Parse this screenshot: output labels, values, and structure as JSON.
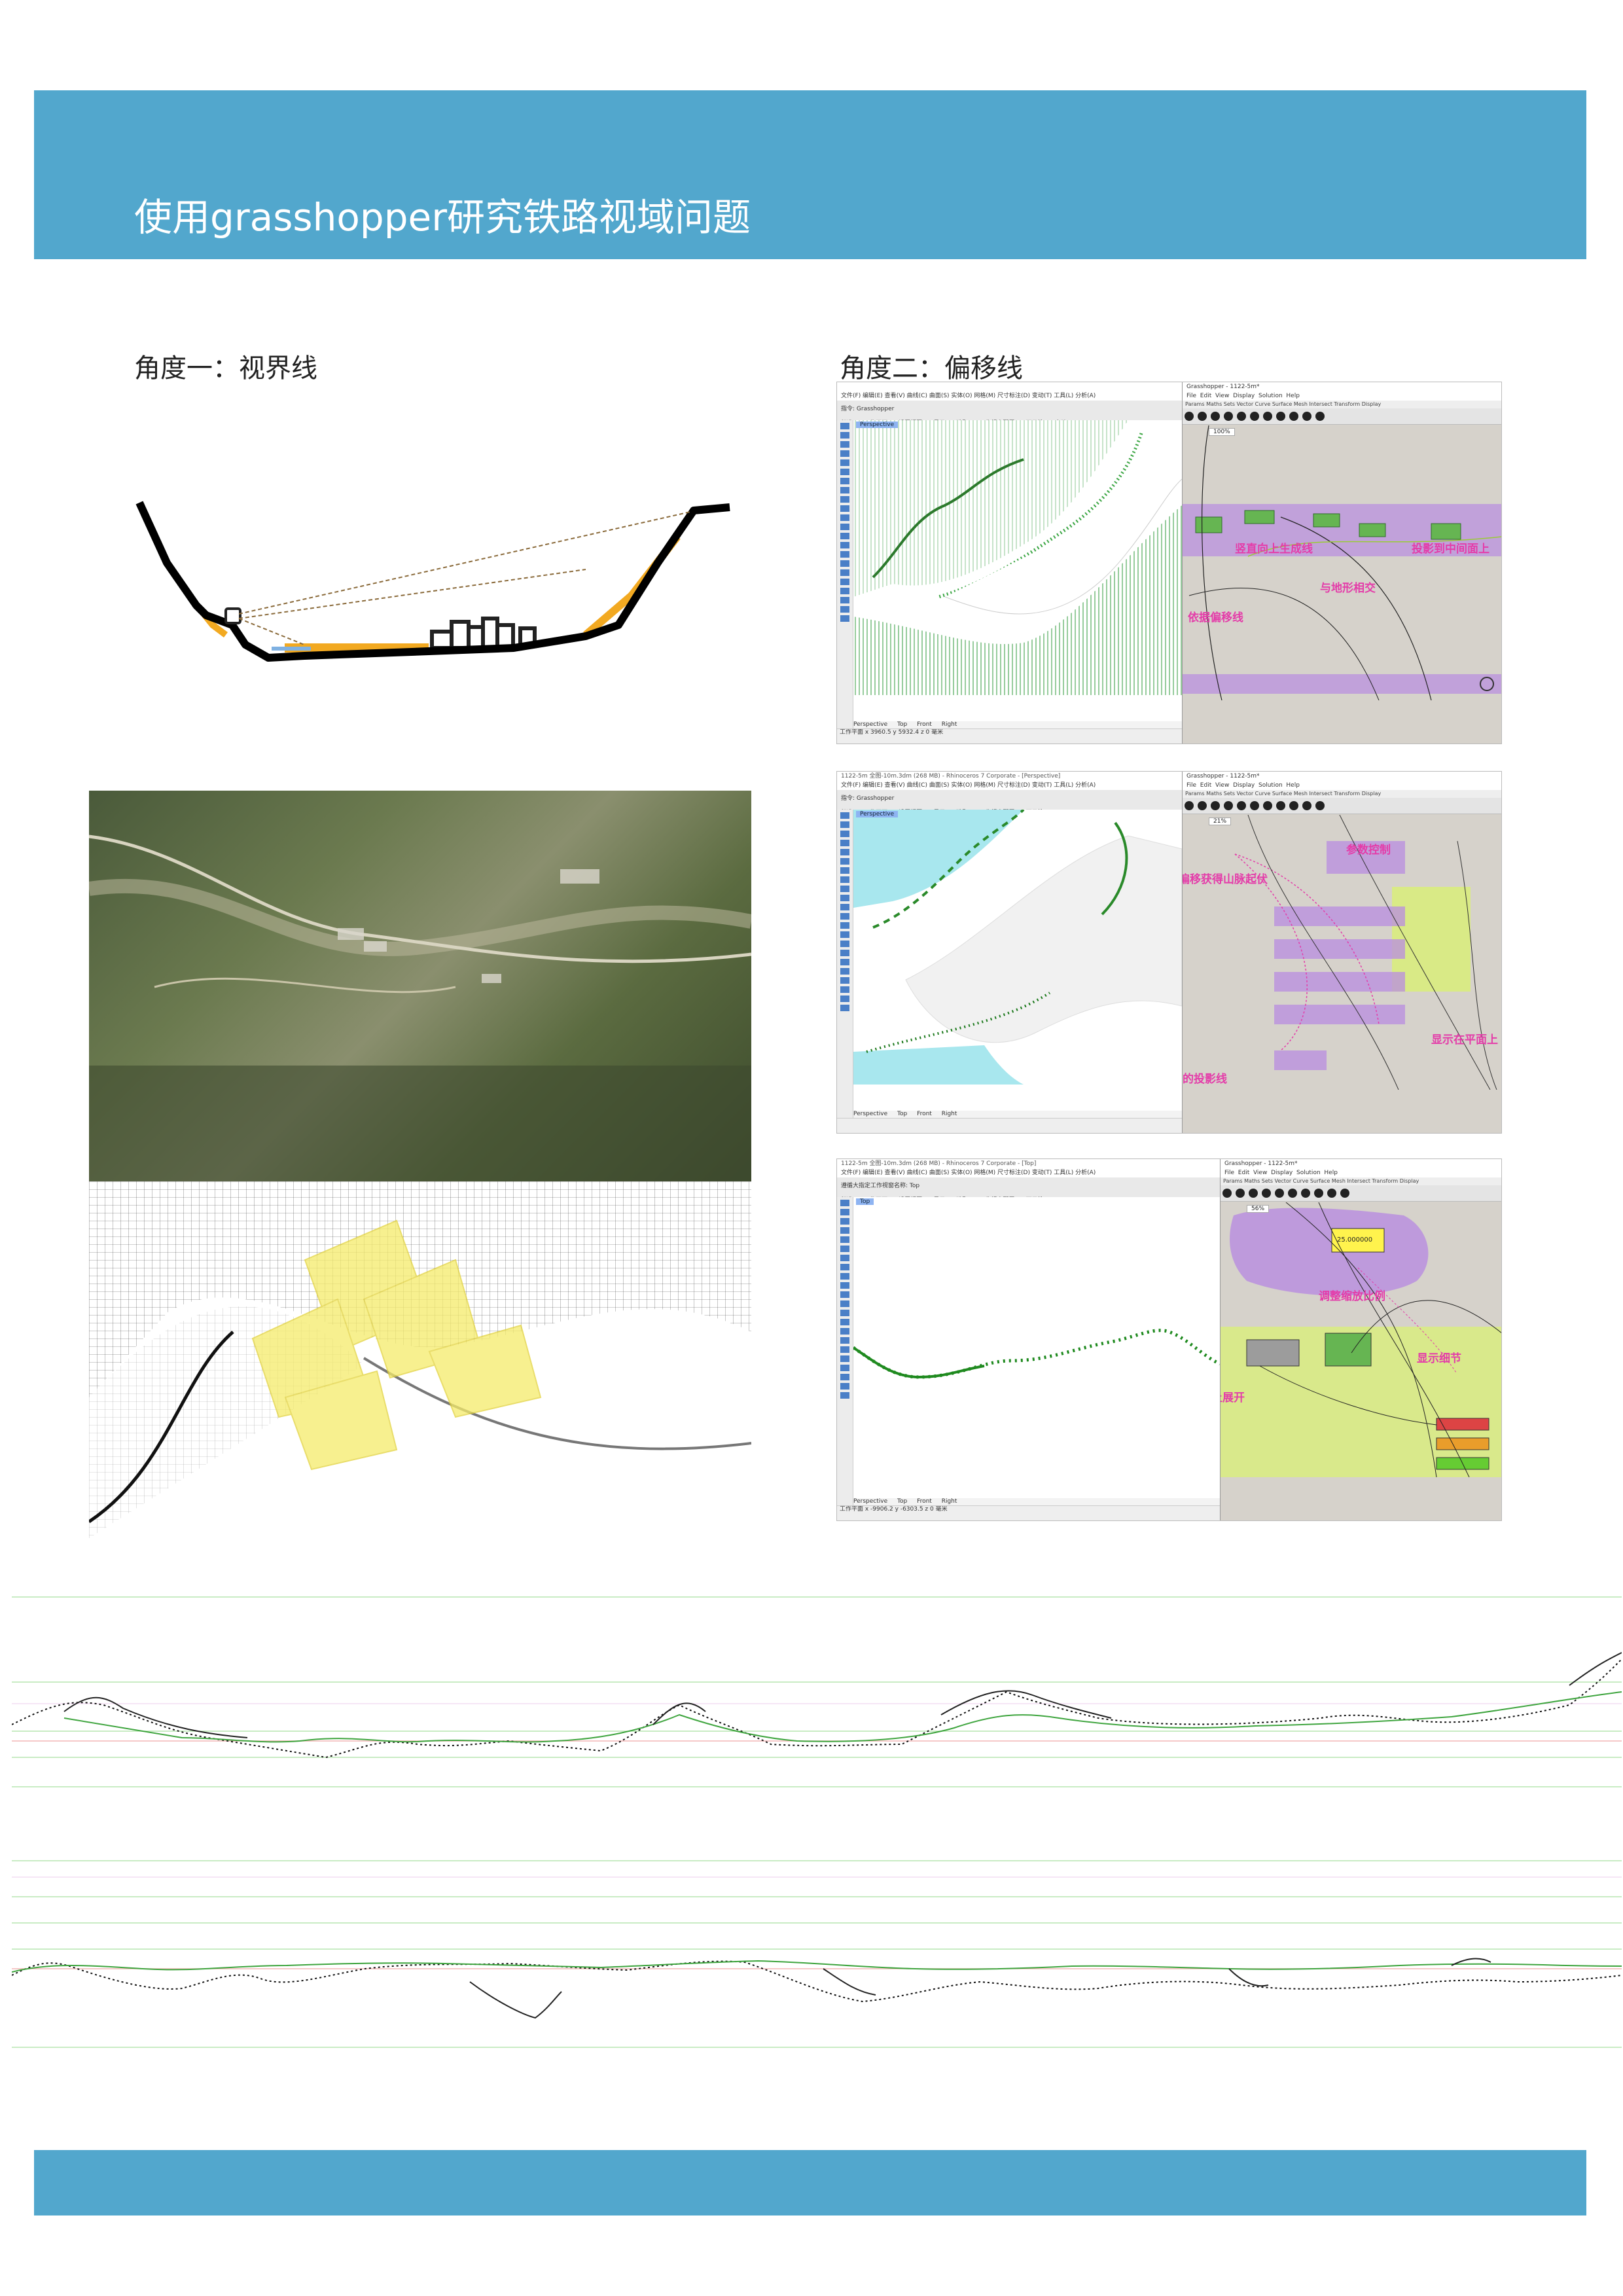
{
  "page": {
    "title": "使用grasshopper研究铁路视域问题",
    "banner_color": "#52a7cd"
  },
  "sections": {
    "angle1": "角度一：视界线",
    "angle2": "角度二：偏移线"
  },
  "screenshot1": {
    "window_title": "",
    "menu": "文件(F)  编辑(E)  查看(V)  曲线(C)  曲面(S)  实体(O)  网格(M)  尺寸标注(D)  变动(T)  工具(L)  分析(A)",
    "sub_menu": "指令: Grasshopper",
    "toolbar_tabs": [
      "标准",
      "工作平面",
      "设置视图",
      "显示",
      "选取",
      "工作视窗配置",
      "可见性",
      "变动",
      "曲线工具",
      "实体工具"
    ],
    "viewport_label": "Perspective",
    "viewport_tabs": [
      "Perspective",
      "Top",
      "Front",
      "Right"
    ],
    "status": "工作平面   x 3960.5   y 5932.4   z 0   毫米",
    "gh_title": "Grasshopper - 1122-5m*",
    "gh_menu": [
      "File",
      "Edit",
      "View",
      "Display",
      "Solution",
      "Help"
    ],
    "gh_tabs": "Params  Maths  Sets  Vector  Curve  Surface  Mesh  Intersect  Transform  Display",
    "gh_zoom": "100%",
    "annotations": [
      "竖直向上生成线",
      "投影到中间面上",
      "与地形相交",
      "依据偏移线"
    ]
  },
  "screenshot2": {
    "window_title": "1122-5m 全图-10m.3dm (268 MB) - Rhinoceros 7 Corporate - [Perspective]",
    "menu": "文件(F)  编辑(E)  查看(V)  曲线(C)  曲面(S)  实体(O)  网格(M)  尺寸标注(D)  变动(T)  工具(L)  分析(A)",
    "sub_menu": "指令: Grasshopper",
    "toolbar_tabs": [
      "标准",
      "工作平面",
      "设置视图",
      "显示",
      "选取",
      "工作视窗配置",
      "可见性",
      "变动",
      "曲线工具"
    ],
    "viewport_label": "Perspective",
    "viewport_tabs": [
      "Perspective",
      "Top",
      "Front",
      "Right"
    ],
    "gh_title": "Grasshopper - 1122-5m*",
    "gh_menu": [
      "File",
      "Edit",
      "View",
      "Display",
      "Solution",
      "Help"
    ],
    "gh_tabs": "Params  Maths  Sets  Vector  Curve  Surface  Mesh  Intersect  Transform  Display",
    "gh_zoom": "21%",
    "annotations": [
      "参数控制",
      "根据偏移获得山脉起伏",
      "显示在平面上",
      "铁路线所在的投影线"
    ]
  },
  "screenshot3": {
    "window_title": "1122-5m 全图-10m.3dm (268 MB) - Rhinoceros 7 Corporate - [Top]",
    "menu": "文件(F)  编辑(E)  查看(V)  曲线(C)  曲面(S)  实体(O)  网格(M)  尺寸标注(D)  变动(T)  工具(L)  分析(A)",
    "sub_menu": "遵循大指定工作视窗名称: Top",
    "toolbar_tabs": [
      "标准",
      "工作平面",
      "设置视图",
      "显示",
      "选取",
      "工作视窗配置",
      "可见性",
      "变动",
      "曲线工具"
    ],
    "viewport_label": "Top",
    "viewport_tabs": [
      "Perspective",
      "Top",
      "Front",
      "Right"
    ],
    "status": "工作平面   x -9906.2   y -6303.5   z 0   毫米",
    "gh_title": "Grasshopper - 1122-5m*",
    "gh_menu": [
      "File",
      "Edit",
      "View",
      "Display",
      "Solution",
      "Help"
    ],
    "gh_tabs": "Params  Maths  Sets  Vector  Curve  Surface  Mesh  Intersect  Transform  Display",
    "gh_zoom": "56%",
    "gh_value": "25.000000",
    "annotations": [
      "调整缩放比例",
      "显示细节",
      "曲面上的点在平面上展开"
    ]
  }
}
